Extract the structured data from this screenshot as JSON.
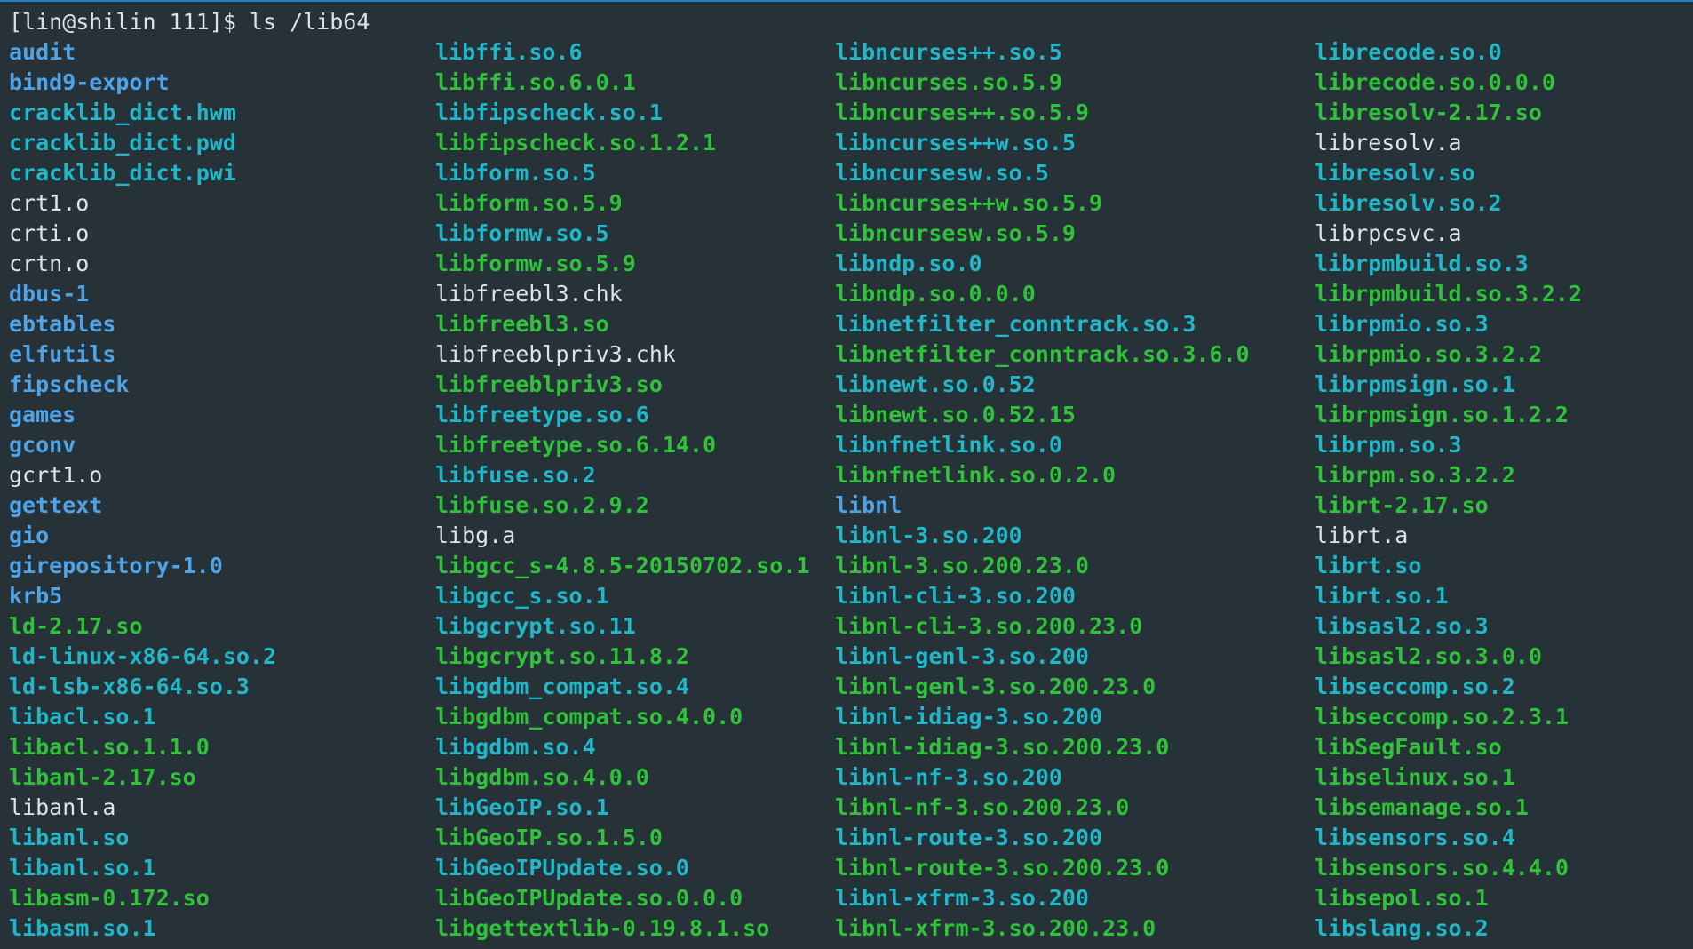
{
  "prompt": "[lin@shilin 111]$ ls /lib64",
  "colors": {
    "background": "#263238",
    "directory": "#4fa3e6",
    "symlink": "#20b8c8",
    "executable": "#2fc23a",
    "regular": "#dfe3e6"
  },
  "columns": [
    [
      {
        "name": "audit",
        "type": "dir"
      },
      {
        "name": "bind9-export",
        "type": "dir"
      },
      {
        "name": "cracklib_dict.hwm",
        "type": "link"
      },
      {
        "name": "cracklib_dict.pwd",
        "type": "link"
      },
      {
        "name": "cracklib_dict.pwi",
        "type": "link"
      },
      {
        "name": "crt1.o",
        "type": "file"
      },
      {
        "name": "crti.o",
        "type": "file"
      },
      {
        "name": "crtn.o",
        "type": "file"
      },
      {
        "name": "dbus-1",
        "type": "dir"
      },
      {
        "name": "ebtables",
        "type": "dir"
      },
      {
        "name": "elfutils",
        "type": "dir"
      },
      {
        "name": "fipscheck",
        "type": "dir"
      },
      {
        "name": "games",
        "type": "dir"
      },
      {
        "name": "gconv",
        "type": "dir"
      },
      {
        "name": "gcrt1.o",
        "type": "file"
      },
      {
        "name": "gettext",
        "type": "dir"
      },
      {
        "name": "gio",
        "type": "dir"
      },
      {
        "name": "girepository-1.0",
        "type": "dir"
      },
      {
        "name": "krb5",
        "type": "dir"
      },
      {
        "name": "ld-2.17.so",
        "type": "exec"
      },
      {
        "name": "ld-linux-x86-64.so.2",
        "type": "link"
      },
      {
        "name": "ld-lsb-x86-64.so.3",
        "type": "link"
      },
      {
        "name": "libacl.so.1",
        "type": "link"
      },
      {
        "name": "libacl.so.1.1.0",
        "type": "exec"
      },
      {
        "name": "libanl-2.17.so",
        "type": "exec"
      },
      {
        "name": "libanl.a",
        "type": "file"
      },
      {
        "name": "libanl.so",
        "type": "link"
      },
      {
        "name": "libanl.so.1",
        "type": "link"
      },
      {
        "name": "libasm-0.172.so",
        "type": "exec"
      },
      {
        "name": "libasm.so.1",
        "type": "link"
      }
    ],
    [
      {
        "name": "libffi.so.6",
        "type": "link"
      },
      {
        "name": "libffi.so.6.0.1",
        "type": "exec"
      },
      {
        "name": "libfipscheck.so.1",
        "type": "link"
      },
      {
        "name": "libfipscheck.so.1.2.1",
        "type": "exec"
      },
      {
        "name": "libform.so.5",
        "type": "link"
      },
      {
        "name": "libform.so.5.9",
        "type": "exec"
      },
      {
        "name": "libformw.so.5",
        "type": "link"
      },
      {
        "name": "libformw.so.5.9",
        "type": "exec"
      },
      {
        "name": "libfreebl3.chk",
        "type": "file"
      },
      {
        "name": "libfreebl3.so",
        "type": "exec"
      },
      {
        "name": "libfreeblpriv3.chk",
        "type": "file"
      },
      {
        "name": "libfreeblpriv3.so",
        "type": "exec"
      },
      {
        "name": "libfreetype.so.6",
        "type": "link"
      },
      {
        "name": "libfreetype.so.6.14.0",
        "type": "exec"
      },
      {
        "name": "libfuse.so.2",
        "type": "link"
      },
      {
        "name": "libfuse.so.2.9.2",
        "type": "exec"
      },
      {
        "name": "libg.a",
        "type": "file"
      },
      {
        "name": "libgcc_s-4.8.5-20150702.so.1",
        "type": "exec"
      },
      {
        "name": "libgcc_s.so.1",
        "type": "link"
      },
      {
        "name": "libgcrypt.so.11",
        "type": "link"
      },
      {
        "name": "libgcrypt.so.11.8.2",
        "type": "exec"
      },
      {
        "name": "libgdbm_compat.so.4",
        "type": "link"
      },
      {
        "name": "libgdbm_compat.so.4.0.0",
        "type": "exec"
      },
      {
        "name": "libgdbm.so.4",
        "type": "link"
      },
      {
        "name": "libgdbm.so.4.0.0",
        "type": "exec"
      },
      {
        "name": "libGeoIP.so.1",
        "type": "link"
      },
      {
        "name": "libGeoIP.so.1.5.0",
        "type": "exec"
      },
      {
        "name": "libGeoIPUpdate.so.0",
        "type": "link"
      },
      {
        "name": "libGeoIPUpdate.so.0.0.0",
        "type": "exec"
      },
      {
        "name": "libgettextlib-0.19.8.1.so",
        "type": "exec"
      }
    ],
    [
      {
        "name": "libncurses++.so.5",
        "type": "link"
      },
      {
        "name": "libncurses.so.5.9",
        "type": "exec"
      },
      {
        "name": "libncurses++.so.5.9",
        "type": "exec"
      },
      {
        "name": "libncurses++w.so.5",
        "type": "link"
      },
      {
        "name": "libncursesw.so.5",
        "type": "link"
      },
      {
        "name": "libncurses++w.so.5.9",
        "type": "exec"
      },
      {
        "name": "libncursesw.so.5.9",
        "type": "exec"
      },
      {
        "name": "libndp.so.0",
        "type": "link"
      },
      {
        "name": "libndp.so.0.0.0",
        "type": "exec"
      },
      {
        "name": "libnetfilter_conntrack.so.3",
        "type": "link"
      },
      {
        "name": "libnetfilter_conntrack.so.3.6.0",
        "type": "exec"
      },
      {
        "name": "libnewt.so.0.52",
        "type": "link"
      },
      {
        "name": "libnewt.so.0.52.15",
        "type": "exec"
      },
      {
        "name": "libnfnetlink.so.0",
        "type": "link"
      },
      {
        "name": "libnfnetlink.so.0.2.0",
        "type": "exec"
      },
      {
        "name": "libnl",
        "type": "dir"
      },
      {
        "name": "libnl-3.so.200",
        "type": "link"
      },
      {
        "name": "libnl-3.so.200.23.0",
        "type": "exec"
      },
      {
        "name": "libnl-cli-3.so.200",
        "type": "link"
      },
      {
        "name": "libnl-cli-3.so.200.23.0",
        "type": "exec"
      },
      {
        "name": "libnl-genl-3.so.200",
        "type": "link"
      },
      {
        "name": "libnl-genl-3.so.200.23.0",
        "type": "exec"
      },
      {
        "name": "libnl-idiag-3.so.200",
        "type": "link"
      },
      {
        "name": "libnl-idiag-3.so.200.23.0",
        "type": "exec"
      },
      {
        "name": "libnl-nf-3.so.200",
        "type": "link"
      },
      {
        "name": "libnl-nf-3.so.200.23.0",
        "type": "exec"
      },
      {
        "name": "libnl-route-3.so.200",
        "type": "link"
      },
      {
        "name": "libnl-route-3.so.200.23.0",
        "type": "exec"
      },
      {
        "name": "libnl-xfrm-3.so.200",
        "type": "link"
      },
      {
        "name": "libnl-xfrm-3.so.200.23.0",
        "type": "exec"
      }
    ],
    [
      {
        "name": "librecode.so.0",
        "type": "link"
      },
      {
        "name": "librecode.so.0.0.0",
        "type": "exec"
      },
      {
        "name": "libresolv-2.17.so",
        "type": "exec"
      },
      {
        "name": "libresolv.a",
        "type": "file"
      },
      {
        "name": "libresolv.so",
        "type": "link"
      },
      {
        "name": "libresolv.so.2",
        "type": "link"
      },
      {
        "name": "librpcsvc.a",
        "type": "file"
      },
      {
        "name": "librpmbuild.so.3",
        "type": "link"
      },
      {
        "name": "librpmbuild.so.3.2.2",
        "type": "exec"
      },
      {
        "name": "librpmio.so.3",
        "type": "link"
      },
      {
        "name": "librpmio.so.3.2.2",
        "type": "exec"
      },
      {
        "name": "librpmsign.so.1",
        "type": "link"
      },
      {
        "name": "librpmsign.so.1.2.2",
        "type": "exec"
      },
      {
        "name": "librpm.so.3",
        "type": "link"
      },
      {
        "name": "librpm.so.3.2.2",
        "type": "exec"
      },
      {
        "name": "librt-2.17.so",
        "type": "exec"
      },
      {
        "name": "librt.a",
        "type": "file"
      },
      {
        "name": "librt.so",
        "type": "link"
      },
      {
        "name": "librt.so.1",
        "type": "link"
      },
      {
        "name": "libsasl2.so.3",
        "type": "link"
      },
      {
        "name": "libsasl2.so.3.0.0",
        "type": "exec"
      },
      {
        "name": "libseccomp.so.2",
        "type": "link"
      },
      {
        "name": "libseccomp.so.2.3.1",
        "type": "exec"
      },
      {
        "name": "libSegFault.so",
        "type": "exec"
      },
      {
        "name": "libselinux.so.1",
        "type": "exec"
      },
      {
        "name": "libsemanage.so.1",
        "type": "exec"
      },
      {
        "name": "libsensors.so.4",
        "type": "link"
      },
      {
        "name": "libsensors.so.4.4.0",
        "type": "exec"
      },
      {
        "name": "libsepol.so.1",
        "type": "exec"
      },
      {
        "name": "libslang.so.2",
        "type": "link"
      }
    ]
  ]
}
